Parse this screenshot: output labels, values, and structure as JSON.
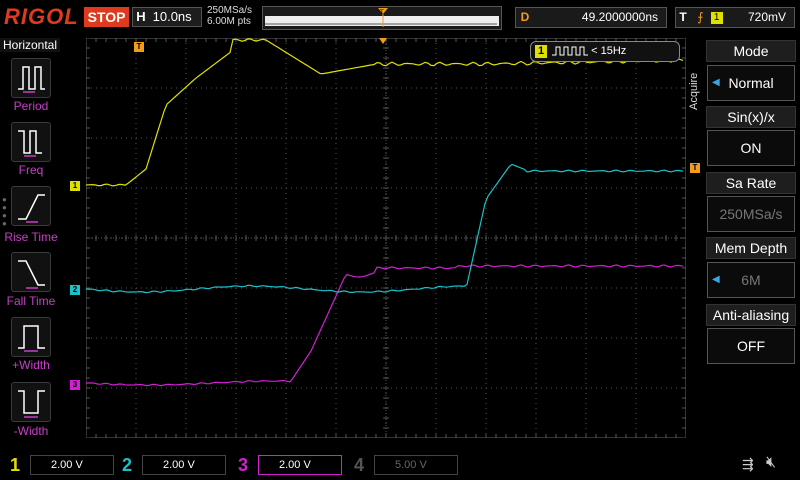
{
  "topbar": {
    "brand": "RIGOL",
    "run_state": "STOP",
    "horizontal": {
      "key": "H",
      "timebase": "10.0ns"
    },
    "sample": {
      "rate": "250MSa/s",
      "points": "6.00M pts"
    },
    "delay": {
      "key": "D",
      "value": "49.2000000ns"
    },
    "trigger": {
      "key": "T",
      "level": "720mV"
    }
  },
  "left_panel": {
    "title": "Horizontal",
    "items": [
      {
        "label": "Period"
      },
      {
        "label": "Freq"
      },
      {
        "label": "Rise Time"
      },
      {
        "label": "Fall Time"
      },
      {
        "label": "+Width"
      },
      {
        "label": "-Width"
      }
    ]
  },
  "freq_counter": {
    "channel": "1",
    "text": "< 15Hz"
  },
  "right_panel": {
    "side_label": "Acquire",
    "items": [
      {
        "title": "Mode",
        "value": "Normal"
      },
      {
        "title": "Sin(x)/x",
        "value": "ON"
      },
      {
        "title": "Sa Rate",
        "value": "250MSa/s"
      },
      {
        "title": "Mem Depth",
        "value": "6M"
      },
      {
        "title": "Anti-aliasing",
        "value": "OFF"
      }
    ]
  },
  "channels": [
    {
      "num": "1",
      "scale": "2.00 V",
      "color": "#e0e000"
    },
    {
      "num": "2",
      "scale": "2.00 V",
      "color": "#19c2c8"
    },
    {
      "num": "3",
      "scale": "2.00 V",
      "color": "#d11fd1"
    },
    {
      "num": "4",
      "scale": "5.00 V",
      "color": "#555555"
    }
  ],
  "markers": {
    "ch1": "1",
    "ch2": "2",
    "ch3": "3",
    "trig_left": "T",
    "trig_right": "T"
  },
  "colors": {
    "ch1": "#e0e000",
    "ch2": "#19c2c8",
    "ch3": "#d11fd1",
    "trigger": "#f39c1a",
    "brand": "#e03a1e"
  }
}
